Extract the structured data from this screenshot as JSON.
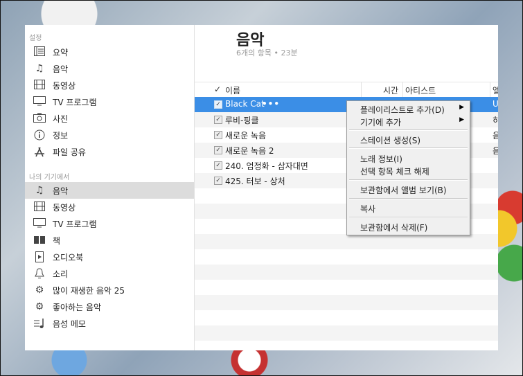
{
  "sidebar": {
    "settings_header": "설정",
    "settings_items": [
      {
        "label": "요약",
        "icon": "summary-icon"
      },
      {
        "label": "음악",
        "icon": "music-note-icon"
      },
      {
        "label": "동영상",
        "icon": "film-icon"
      },
      {
        "label": "TV 프로그램",
        "icon": "tv-icon"
      },
      {
        "label": "사진",
        "icon": "camera-icon"
      },
      {
        "label": "정보",
        "icon": "info-icon"
      },
      {
        "label": "파일 공유",
        "icon": "app-store-icon"
      }
    ],
    "device_header": "나의 기기에서",
    "device_items": [
      {
        "label": "음악",
        "icon": "music-note-icon",
        "selected": true
      },
      {
        "label": "동영상",
        "icon": "film-icon"
      },
      {
        "label": "TV 프로그램",
        "icon": "tv-icon"
      },
      {
        "label": "책",
        "icon": "book-icon"
      },
      {
        "label": "오디오북",
        "icon": "audiobook-icon"
      },
      {
        "label": "소리",
        "icon": "bell-icon"
      },
      {
        "label": "많이 재생한 음악 25",
        "icon": "gear-icon"
      },
      {
        "label": "좋아하는 음악",
        "icon": "gear-icon"
      },
      {
        "label": "음성 메모",
        "icon": "voice-memo-icon"
      }
    ]
  },
  "main": {
    "title": "음악",
    "subtitle": "6개의 항목 • 23분",
    "columns": {
      "check": "✓",
      "name": "이름",
      "time": "시간",
      "artist": "아티스트",
      "album": "앨"
    },
    "rows": [
      {
        "name": "Black Cat",
        "album": "U",
        "checked": true,
        "selected": true
      },
      {
        "name": "루비-핑클",
        "album": "히",
        "checked": true
      },
      {
        "name": "새로운 녹음",
        "album": "음",
        "checked": true
      },
      {
        "name": "새로운 녹음 2",
        "album": "음",
        "checked": true
      },
      {
        "name": "240. 엄정화 - 삼자대면",
        "album": "",
        "checked": true
      },
      {
        "name": "425. 터보 - 상처",
        "album": "",
        "checked": true
      }
    ],
    "row_more": "•••"
  },
  "context_menu": {
    "items": [
      {
        "label": "플레이리스트로 추가(D)",
        "submenu": true
      },
      {
        "label": "기기에 추가",
        "submenu": true
      },
      {
        "label": "스테이션 생성(S)"
      },
      {
        "label": "노래 정보(I)"
      },
      {
        "label": "선택 항목 체크 해제"
      },
      {
        "label": "보관함에서 앨범 보기(B)"
      },
      {
        "label": "복사"
      },
      {
        "label": "보관함에서 삭제(F)"
      }
    ],
    "submenu_arrow": "▶"
  },
  "colors": {
    "selection": "#3b8ee6",
    "sidebar_selected": "#dcdcdc"
  }
}
